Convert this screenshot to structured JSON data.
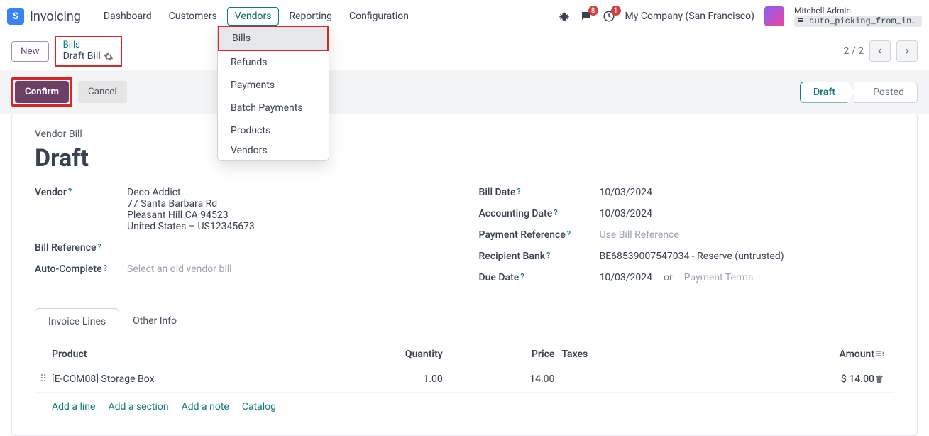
{
  "nav": {
    "app_name": "Invoicing",
    "items": [
      "Dashboard",
      "Customers",
      "Vendors",
      "Reporting",
      "Configuration"
    ],
    "active_index": 2
  },
  "dropdown": {
    "items": [
      "Bills",
      "Refunds",
      "Payments",
      "Batch Payments",
      "Products",
      "Vendors"
    ],
    "hover_index": 0
  },
  "top_right": {
    "messages_badge": "8",
    "activities_badge": "1",
    "company": "My Company (San Francisco)",
    "user_name": "Mitchell Admin",
    "user_sub": "auto_picking_from_invoic…"
  },
  "subbar": {
    "new_label": "New",
    "breadcrumb_parent": "Bills",
    "breadcrumb_current": "Draft Bill",
    "pager_text": "2 / 2"
  },
  "actions": {
    "confirm": "Confirm",
    "cancel": "Cancel",
    "status_draft": "Draft",
    "status_posted": "Posted"
  },
  "form": {
    "section": "Vendor Bill",
    "title": "Draft",
    "left": {
      "vendor_label": "Vendor",
      "vendor_name": "Deco Addict",
      "vendor_addr1": "77 Santa Barbara Rd",
      "vendor_addr2": "Pleasant Hill CA 94523",
      "vendor_addr3": "United States – US12345673",
      "bill_ref_label": "Bill Reference",
      "autocomplete_label": "Auto-Complete",
      "autocomplete_placeholder": "Select an old vendor bill"
    },
    "right": {
      "bill_date_label": "Bill Date",
      "bill_date": "10/03/2024",
      "acct_date_label": "Accounting Date",
      "acct_date": "10/03/2024",
      "pay_ref_label": "Payment Reference",
      "pay_ref_placeholder": "Use Bill Reference",
      "bank_label": "Recipient Bank",
      "bank": "BE68539007547034 - Reserve (untrusted)",
      "due_label": "Due Date",
      "due_date": "10/03/2024",
      "or_text": "or",
      "terms_placeholder": "Payment Terms"
    }
  },
  "tabs": {
    "items": [
      "Invoice Lines",
      "Other Info"
    ],
    "active_index": 0,
    "columns": {
      "product": "Product",
      "qty": "Quantity",
      "price": "Price",
      "taxes": "Taxes",
      "amount": "Amount"
    },
    "line": {
      "product": "[E-COM08] Storage Box",
      "qty": "1.00",
      "price": "14.00",
      "taxes": "",
      "amount": "$ 14.00"
    },
    "add_links": [
      "Add a line",
      "Add a section",
      "Add a note",
      "Catalog"
    ]
  }
}
